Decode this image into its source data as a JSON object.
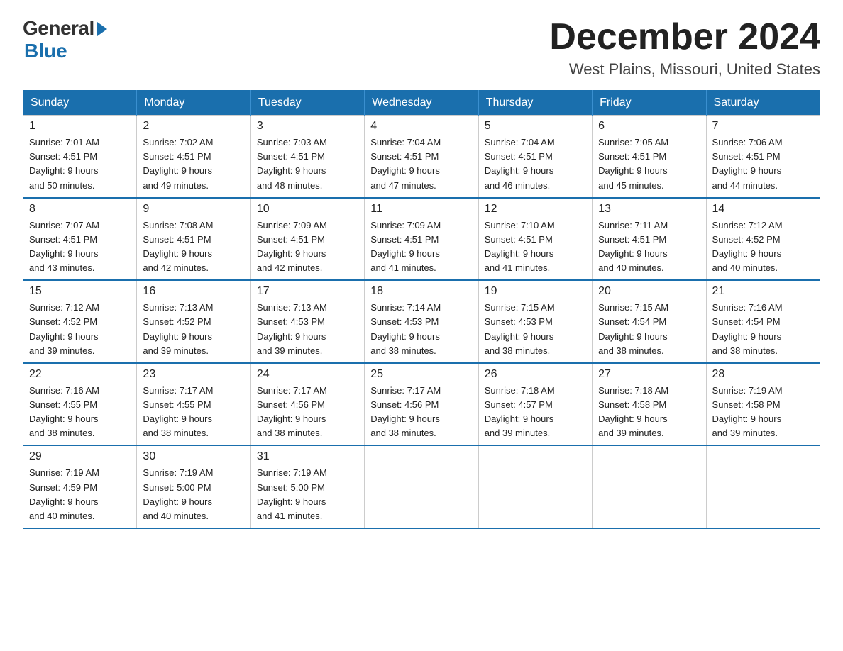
{
  "header": {
    "logo": {
      "general": "General",
      "blue": "Blue"
    },
    "title": "December 2024",
    "location": "West Plains, Missouri, United States"
  },
  "weekdays": [
    "Sunday",
    "Monday",
    "Tuesday",
    "Wednesday",
    "Thursday",
    "Friday",
    "Saturday"
  ],
  "weeks": [
    [
      {
        "day": "1",
        "sunrise": "7:01 AM",
        "sunset": "4:51 PM",
        "daylight": "9 hours and 50 minutes."
      },
      {
        "day": "2",
        "sunrise": "7:02 AM",
        "sunset": "4:51 PM",
        "daylight": "9 hours and 49 minutes."
      },
      {
        "day": "3",
        "sunrise": "7:03 AM",
        "sunset": "4:51 PM",
        "daylight": "9 hours and 48 minutes."
      },
      {
        "day": "4",
        "sunrise": "7:04 AM",
        "sunset": "4:51 PM",
        "daylight": "9 hours and 47 minutes."
      },
      {
        "day": "5",
        "sunrise": "7:04 AM",
        "sunset": "4:51 PM",
        "daylight": "9 hours and 46 minutes."
      },
      {
        "day": "6",
        "sunrise": "7:05 AM",
        "sunset": "4:51 PM",
        "daylight": "9 hours and 45 minutes."
      },
      {
        "day": "7",
        "sunrise": "7:06 AM",
        "sunset": "4:51 PM",
        "daylight": "9 hours and 44 minutes."
      }
    ],
    [
      {
        "day": "8",
        "sunrise": "7:07 AM",
        "sunset": "4:51 PM",
        "daylight": "9 hours and 43 minutes."
      },
      {
        "day": "9",
        "sunrise": "7:08 AM",
        "sunset": "4:51 PM",
        "daylight": "9 hours and 42 minutes."
      },
      {
        "day": "10",
        "sunrise": "7:09 AM",
        "sunset": "4:51 PM",
        "daylight": "9 hours and 42 minutes."
      },
      {
        "day": "11",
        "sunrise": "7:09 AM",
        "sunset": "4:51 PM",
        "daylight": "9 hours and 41 minutes."
      },
      {
        "day": "12",
        "sunrise": "7:10 AM",
        "sunset": "4:51 PM",
        "daylight": "9 hours and 41 minutes."
      },
      {
        "day": "13",
        "sunrise": "7:11 AM",
        "sunset": "4:51 PM",
        "daylight": "9 hours and 40 minutes."
      },
      {
        "day": "14",
        "sunrise": "7:12 AM",
        "sunset": "4:52 PM",
        "daylight": "9 hours and 40 minutes."
      }
    ],
    [
      {
        "day": "15",
        "sunrise": "7:12 AM",
        "sunset": "4:52 PM",
        "daylight": "9 hours and 39 minutes."
      },
      {
        "day": "16",
        "sunrise": "7:13 AM",
        "sunset": "4:52 PM",
        "daylight": "9 hours and 39 minutes."
      },
      {
        "day": "17",
        "sunrise": "7:13 AM",
        "sunset": "4:53 PM",
        "daylight": "9 hours and 39 minutes."
      },
      {
        "day": "18",
        "sunrise": "7:14 AM",
        "sunset": "4:53 PM",
        "daylight": "9 hours and 38 minutes."
      },
      {
        "day": "19",
        "sunrise": "7:15 AM",
        "sunset": "4:53 PM",
        "daylight": "9 hours and 38 minutes."
      },
      {
        "day": "20",
        "sunrise": "7:15 AM",
        "sunset": "4:54 PM",
        "daylight": "9 hours and 38 minutes."
      },
      {
        "day": "21",
        "sunrise": "7:16 AM",
        "sunset": "4:54 PM",
        "daylight": "9 hours and 38 minutes."
      }
    ],
    [
      {
        "day": "22",
        "sunrise": "7:16 AM",
        "sunset": "4:55 PM",
        "daylight": "9 hours and 38 minutes."
      },
      {
        "day": "23",
        "sunrise": "7:17 AM",
        "sunset": "4:55 PM",
        "daylight": "9 hours and 38 minutes."
      },
      {
        "day": "24",
        "sunrise": "7:17 AM",
        "sunset": "4:56 PM",
        "daylight": "9 hours and 38 minutes."
      },
      {
        "day": "25",
        "sunrise": "7:17 AM",
        "sunset": "4:56 PM",
        "daylight": "9 hours and 38 minutes."
      },
      {
        "day": "26",
        "sunrise": "7:18 AM",
        "sunset": "4:57 PM",
        "daylight": "9 hours and 39 minutes."
      },
      {
        "day": "27",
        "sunrise": "7:18 AM",
        "sunset": "4:58 PM",
        "daylight": "9 hours and 39 minutes."
      },
      {
        "day": "28",
        "sunrise": "7:19 AM",
        "sunset": "4:58 PM",
        "daylight": "9 hours and 39 minutes."
      }
    ],
    [
      {
        "day": "29",
        "sunrise": "7:19 AM",
        "sunset": "4:59 PM",
        "daylight": "9 hours and 40 minutes."
      },
      {
        "day": "30",
        "sunrise": "7:19 AM",
        "sunset": "5:00 PM",
        "daylight": "9 hours and 40 minutes."
      },
      {
        "day": "31",
        "sunrise": "7:19 AM",
        "sunset": "5:00 PM",
        "daylight": "9 hours and 41 minutes."
      },
      null,
      null,
      null,
      null
    ]
  ],
  "labels": {
    "sunrise": "Sunrise:",
    "sunset": "Sunset:",
    "daylight": "Daylight:"
  }
}
